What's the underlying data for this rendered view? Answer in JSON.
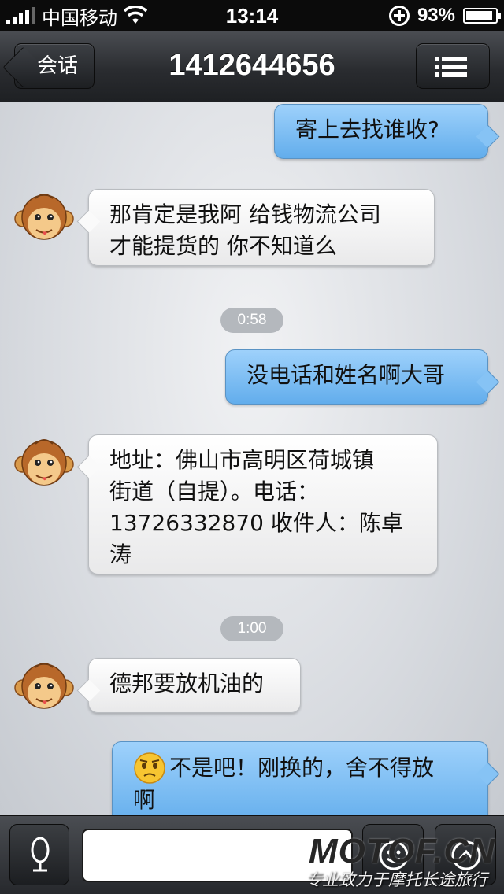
{
  "status_bar": {
    "carrier": "中国移动",
    "time": "13:14",
    "battery_text": "93%",
    "battery_level": 0.93,
    "icons": [
      "signal-icon",
      "wifi-icon",
      "rotation-lock-icon",
      "battery-icon"
    ]
  },
  "nav": {
    "back_label": "会话",
    "title": "1412644656",
    "menu_icon": "list-icon"
  },
  "messages": [
    {
      "direction": "out",
      "lines": [
        "寄上去找谁收?"
      ]
    },
    {
      "direction": "in",
      "lines": [
        "那肯定是我阿 给钱物流公司",
        "才能提货的 你不知道么"
      ]
    },
    {
      "timestamp": "0:58"
    },
    {
      "direction": "out",
      "lines": [
        "没电话和姓名啊大哥"
      ]
    },
    {
      "direction": "in",
      "lines": [
        "地址：佛山市高明区荷城镇",
        "街道（自提）。电话：",
        "13726332870 收件人：陈卓",
        "涛"
      ]
    },
    {
      "timestamp": "1:00"
    },
    {
      "direction": "in",
      "lines": [
        "德邦要放机油的"
      ]
    },
    {
      "direction": "out",
      "emoji": "worried-face-emoji",
      "lines": [
        "不是吧！刚换的，舍不得放",
        "啊"
      ]
    }
  ],
  "input_bar": {
    "voice_icon": "microphone-icon",
    "emoji_icon": "smiley-icon",
    "more_icon": "chevron-up-icon",
    "text_value": ""
  },
  "watermark": {
    "brand": "MOTOF.CN",
    "slogan": "专业致力于摩托长途旅行"
  },
  "colors": {
    "outgoing_bubble": "#7fbff2",
    "incoming_bubble": "#ffffff",
    "nav_bar": "#2a2c30",
    "chat_background": "#dcdfe3"
  }
}
